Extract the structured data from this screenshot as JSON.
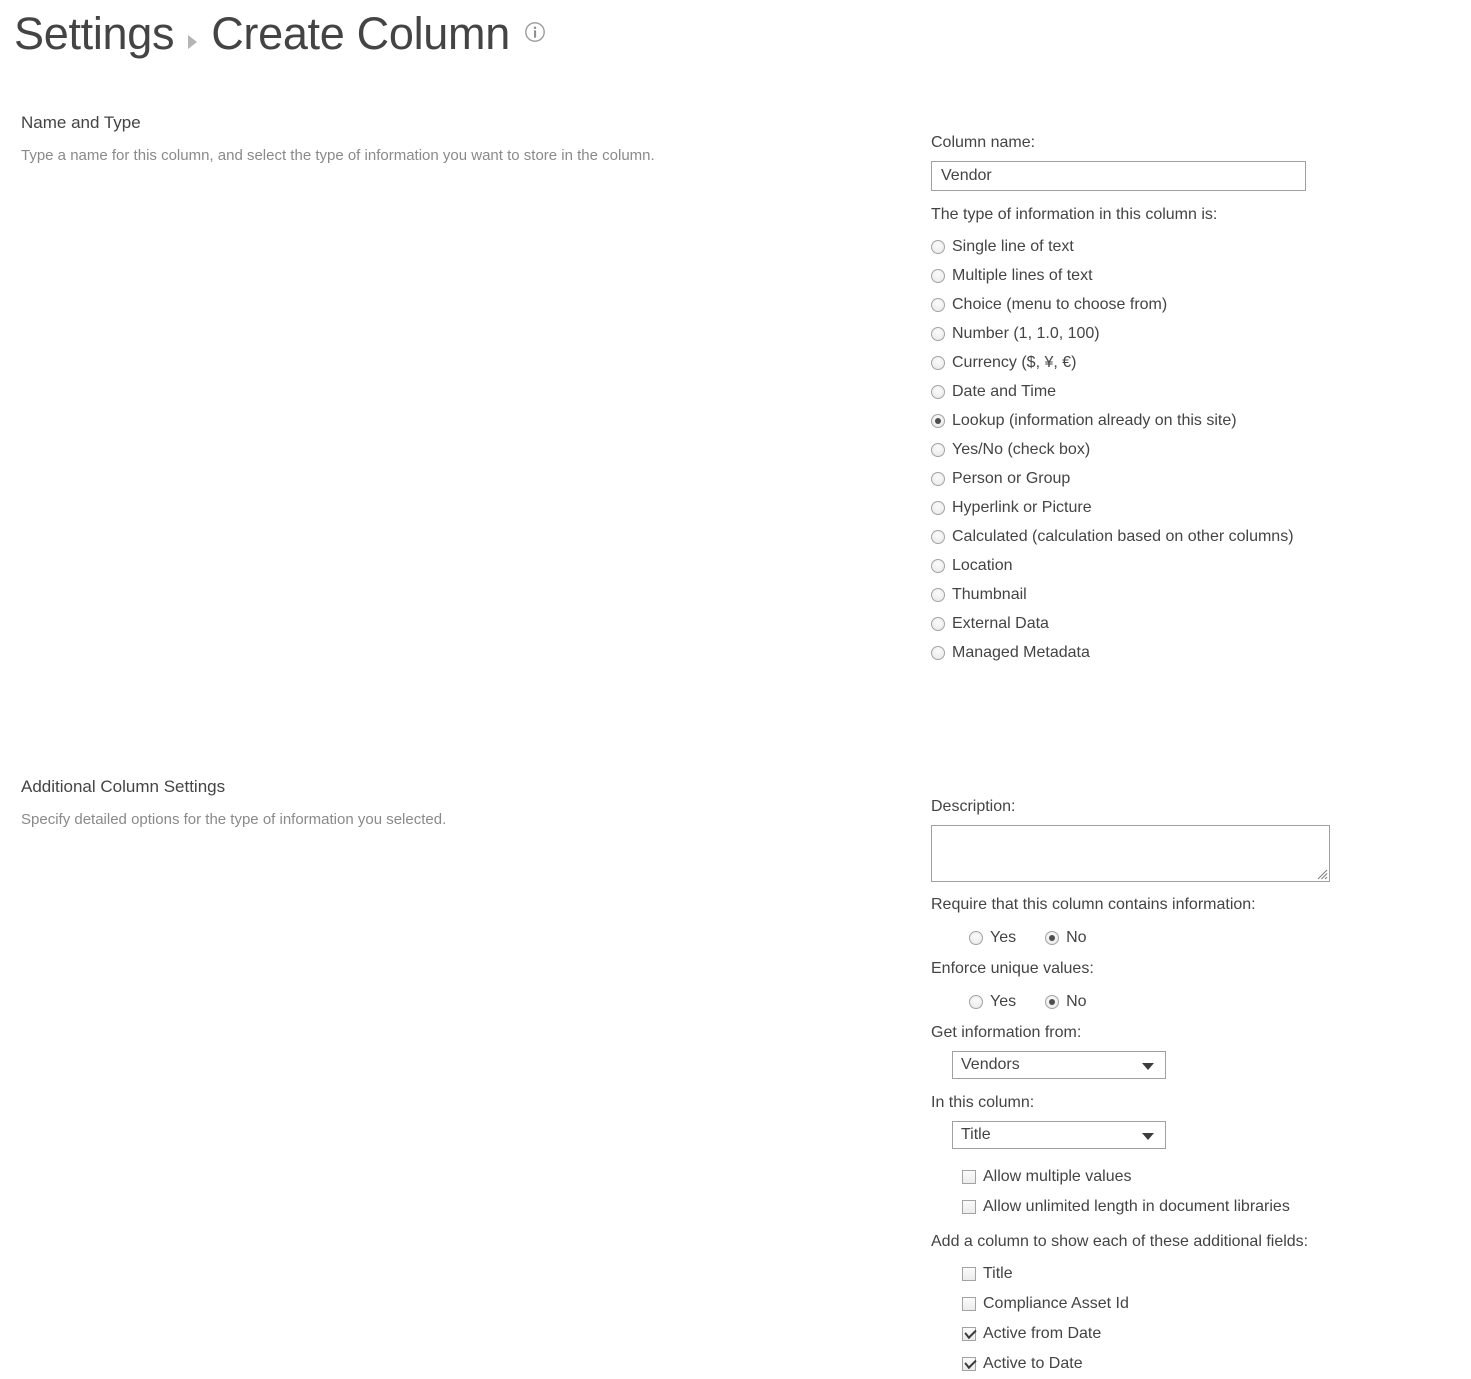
{
  "header": {
    "crumb_parent": "Settings",
    "crumb_separator_icon": "caret-right-icon",
    "crumb_current": "Create Column",
    "info_icon": "info-circle-icon"
  },
  "colors": {
    "text": "#444444",
    "muted_text": "#8a8a8a",
    "border": "#a0a0a0",
    "control_border": "#a3a3a3",
    "background": "#ffffff",
    "radio_dot": "#4d4d4d",
    "arrow": "#3c3c3c"
  },
  "sections": {
    "name_and_type": {
      "title": "Name and Type",
      "description": "Type a name for this column, and select the type of information you want to store in the column."
    },
    "additional_settings": {
      "title": "Additional Column Settings",
      "description": "Specify detailed options for the type of information you selected."
    }
  },
  "column_name": {
    "label": "Column name:",
    "value": "Vendor",
    "placeholder": ""
  },
  "column_type": {
    "label": "The type of information in this column is:",
    "selected": "Lookup (information already on this site)",
    "options": [
      {
        "label": "Single line of text",
        "checked": false
      },
      {
        "label": "Multiple lines of text",
        "checked": false
      },
      {
        "label": "Choice (menu to choose from)",
        "checked": false
      },
      {
        "label": "Number (1, 1.0, 100)",
        "checked": false
      },
      {
        "label": "Currency ($, ¥, €)",
        "checked": false
      },
      {
        "label": "Date and Time",
        "checked": false
      },
      {
        "label": "Lookup (information already on this site)",
        "checked": true
      },
      {
        "label": "Yes/No (check box)",
        "checked": false
      },
      {
        "label": "Person or Group",
        "checked": false
      },
      {
        "label": "Hyperlink or Picture",
        "checked": false
      },
      {
        "label": "Calculated (calculation based on other columns)",
        "checked": false
      },
      {
        "label": "Location",
        "checked": false
      },
      {
        "label": "Thumbnail",
        "checked": false
      },
      {
        "label": "External Data",
        "checked": false
      },
      {
        "label": "Managed Metadata",
        "checked": false
      }
    ]
  },
  "description_field": {
    "label": "Description:",
    "value": "",
    "placeholder": ""
  },
  "require_info": {
    "label": "Require that this column contains information:",
    "yes_label": "Yes",
    "no_label": "No",
    "selected": "No"
  },
  "enforce_unique": {
    "label": "Enforce unique values:",
    "yes_label": "Yes",
    "no_label": "No",
    "selected": "No"
  },
  "get_information_from": {
    "label": "Get information from:",
    "selected": "Vendors",
    "arrow_icon": "caret-down-icon"
  },
  "in_this_column": {
    "label": "In this column:",
    "selected": "Title",
    "arrow_icon": "caret-down-icon"
  },
  "lookup_options": [
    {
      "label": "Allow multiple values",
      "checked": false
    },
    {
      "label": "Allow unlimited length in document libraries",
      "checked": false
    }
  ],
  "additional_fields": {
    "label": "Add a column to show each of these additional fields:",
    "items": [
      {
        "label": "Title",
        "checked": false
      },
      {
        "label": "Compliance Asset Id",
        "checked": false
      },
      {
        "label": "Active from Date",
        "checked": true
      },
      {
        "label": "Active to Date",
        "checked": true
      }
    ]
  }
}
